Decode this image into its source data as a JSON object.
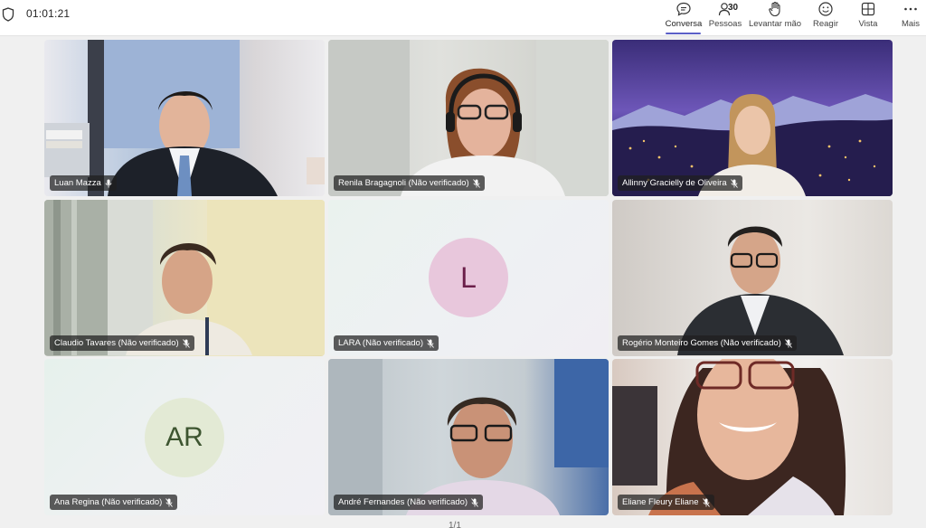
{
  "header": {
    "timer": "01:01:21",
    "buttons": [
      {
        "label": "Conversa",
        "icon": "chat-icon"
      },
      {
        "label": "Pessoas",
        "icon": "people-icon",
        "count": "30"
      },
      {
        "label": "Levantar mão",
        "icon": "raise-hand-icon"
      },
      {
        "label": "Reagir",
        "icon": "smiley-icon"
      },
      {
        "label": "Vista",
        "icon": "grid-view-icon"
      },
      {
        "label": "Mais",
        "icon": "more-icon"
      }
    ],
    "accent": "#5b5fc7"
  },
  "participants": [
    {
      "name": "Luan Mazza",
      "mic": "on"
    },
    {
      "name": "Renila Bragagnoli (Não verificado)",
      "mic": "muted"
    },
    {
      "name": "Allinny Gracielly de Oliveira",
      "mic": "muted"
    },
    {
      "name": "Claudio Tavares (Não verificado)",
      "mic": "muted"
    },
    {
      "name": "LARA (Não verificado)",
      "mic": "muted",
      "initials": "L",
      "avatar_color": "#e8c7dc",
      "initials_color": "#6b1f4a"
    },
    {
      "name": "Rogério Monteiro Gomes (Não verificado)",
      "mic": "muted"
    },
    {
      "name": "Ana Regina (Não verificado)",
      "mic": "muted",
      "initials": "AR",
      "avatar_color": "#e3ead5",
      "initials_color": "#3d5530"
    },
    {
      "name": "André Fernandes (Não verificado)",
      "mic": "muted"
    },
    {
      "name": "Eliane Fleury Eliane",
      "mic": "muted"
    }
  ],
  "pager": "1/1"
}
